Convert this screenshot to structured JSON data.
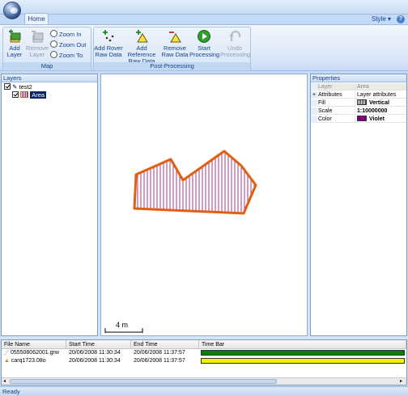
{
  "titlebar": {
    "style_label": "Style",
    "help_label": "?"
  },
  "ribbon": {
    "tab_home": "Home",
    "map_group": {
      "label": "Map",
      "add_layer": "Add\nLayer",
      "remove_layer": "Remove\nLayer",
      "zoom_in": "Zoom In",
      "zoom_out": "Zoom Out",
      "zoom_to_fit": "Zoom To Fit"
    },
    "post_group": {
      "label": "Post-Processing",
      "add_rover": "Add Rover\nRaw Data",
      "add_reference": "Add Reference\nRaw Data",
      "remove_raw": "Remove\nRaw Data",
      "start_processing": "Start\nProcessing",
      "undo_processing": "Undo\nProcessing"
    }
  },
  "layers": {
    "title": "Layers",
    "root": "test2",
    "child": "Area"
  },
  "map": {
    "scale_label": "4 m"
  },
  "properties": {
    "title": "Properties",
    "header": {
      "name": "Layer",
      "value": "Area"
    },
    "rows": [
      {
        "name": "Attributes",
        "value": "Layer attributes",
        "expand": "+"
      },
      {
        "name": "Fill",
        "value": "Vertical"
      },
      {
        "name": "Scale",
        "value": "1:10000000"
      },
      {
        "name": "Color",
        "value": "Violet"
      }
    ]
  },
  "timetable": {
    "columns": [
      "File Name",
      "Start Time",
      "End Time",
      "Time Bar"
    ],
    "rows": [
      {
        "file": "055508062001.grw",
        "start": "20/06/2008 11:30:34",
        "end": "20/06/2008 11:37:57",
        "bar_color": "#008000",
        "bar_fraction": 1.0
      },
      {
        "file": "carq1723.08o",
        "start": "20/06/2008 11:30:34",
        "end": "20/06/2008 11:37:57",
        "bar_color": "#f2f200",
        "bar_fraction": 1.0
      }
    ]
  },
  "status": {
    "text": "Ready"
  },
  "colors": {
    "area_outline": "#e06010",
    "area_hatch": "#a0207a",
    "violet_swatch": "#800080"
  }
}
